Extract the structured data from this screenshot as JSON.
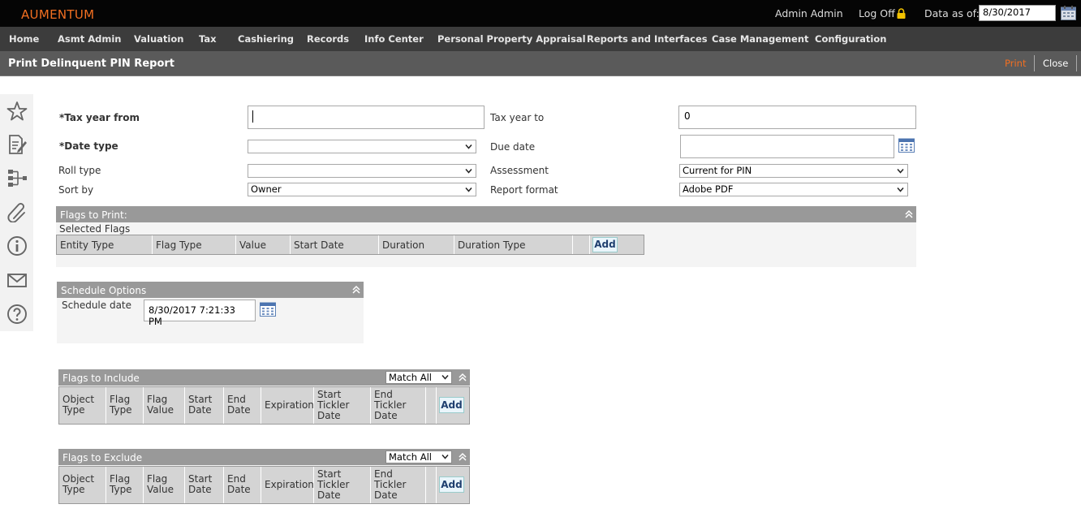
{
  "header": {
    "logo": "AUMENTUM",
    "user": "Admin Admin",
    "logoff": "Log Off",
    "data_as_of_label": "Data as of:",
    "data_as_of_value": "8/30/2017"
  },
  "nav": {
    "items": [
      "Home",
      "Asmt Admin",
      "Valuation",
      "Tax",
      "Cashiering",
      "Records",
      "Info Center",
      "Personal Property Appraisal",
      "Reports and Interfaces",
      "Case Management",
      "Configuration"
    ]
  },
  "titlebar": {
    "title": "Print Delinquent PIN Report",
    "print": "Print",
    "close": "Close"
  },
  "sidebar": {
    "icons": [
      "star-icon",
      "edit-document-icon",
      "hierarchy-icon",
      "paperclip-icon",
      "info-icon",
      "mail-icon",
      "help-icon"
    ]
  },
  "form": {
    "tax_year_from_label": "*Tax year from",
    "tax_year_from_value": "",
    "tax_year_to_label": "Tax year to",
    "tax_year_to_value": "0",
    "date_type_label": "*Date type",
    "date_type_value": "",
    "due_date_label": "Due date",
    "due_date_value": "",
    "roll_type_label": "Roll type",
    "roll_type_value": "",
    "assessment_label": "Assessment",
    "assessment_value": "Current for PIN",
    "sort_by_label": "Sort by",
    "sort_by_value": "Owner",
    "report_format_label": "Report format",
    "report_format_value": "Adobe PDF"
  },
  "flags_to_print": {
    "title": "Flags to Print:",
    "subtitle": "Selected Flags",
    "columns": [
      "Entity Type",
      "Flag Type",
      "Value",
      "Start Date",
      "Duration",
      "Duration Type"
    ],
    "add": "Add"
  },
  "schedule": {
    "title": "Schedule Options",
    "date_label": "Schedule date",
    "date_value": "8/30/2017 7:21:33 PM"
  },
  "flags_to_include": {
    "title": "Flags to Include",
    "match": "Match All",
    "columns": [
      [
        "Object",
        "Type"
      ],
      [
        "Flag",
        "Type"
      ],
      [
        "Flag",
        "Value"
      ],
      [
        "Start",
        "Date"
      ],
      [
        "End",
        "Date"
      ],
      [
        "Expiration"
      ],
      [
        "Start",
        "Tickler",
        "Date"
      ],
      [
        "End",
        "Tickler",
        "Date"
      ]
    ],
    "add": "Add"
  },
  "flags_to_exclude": {
    "title": "Flags to Exclude",
    "match": "Match All",
    "columns": [
      [
        "Object",
        "Type"
      ],
      [
        "Flag",
        "Type"
      ],
      [
        "Flag",
        "Value"
      ],
      [
        "Start",
        "Date"
      ],
      [
        "End",
        "Date"
      ],
      [
        "Expiration"
      ],
      [
        "Start",
        "Tickler",
        "Date"
      ],
      [
        "End",
        "Tickler",
        "Date"
      ]
    ],
    "add": "Add"
  },
  "colors": {
    "brand_orange": "#f26f21",
    "topbar": "#050505",
    "nav": "#3c3c3c",
    "titlebar": "#5a5a5a",
    "panel_header": "#999999"
  }
}
